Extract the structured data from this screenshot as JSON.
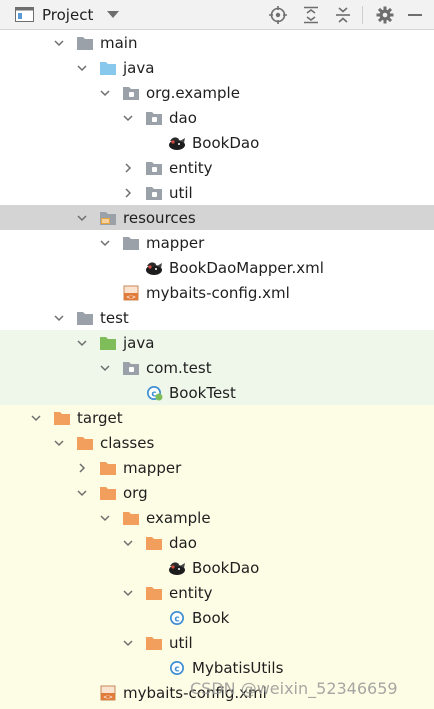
{
  "toolbar": {
    "title": "Project",
    "actions": [
      "locate-icon",
      "expand-all-icon",
      "collapse-all-icon",
      "settings-icon"
    ]
  },
  "colors": {
    "selected_row": "#d4d4d4",
    "test_band": "#eef7ea",
    "target_band": "#fdfde6",
    "folder_gray": "#9aa1a8",
    "folder_source": "#87c8ec",
    "folder_test": "#7ebd5a",
    "folder_excluded": "#f29e5c"
  },
  "tree": [
    {
      "label": "main",
      "depth": 2,
      "arrow": "down",
      "icon": "folder-gray"
    },
    {
      "label": "java",
      "depth": 3,
      "arrow": "down",
      "icon": "folder-source"
    },
    {
      "label": "org.example",
      "depth": 4,
      "arrow": "down",
      "icon": "package"
    },
    {
      "label": "dao",
      "depth": 5,
      "arrow": "down",
      "icon": "package"
    },
    {
      "label": "BookDao",
      "depth": 6,
      "arrow": "none",
      "icon": "mybatis"
    },
    {
      "label": "entity",
      "depth": 5,
      "arrow": "right",
      "icon": "package"
    },
    {
      "label": "util",
      "depth": 5,
      "arrow": "right",
      "icon": "package"
    },
    {
      "label": "resources",
      "depth": 3,
      "arrow": "down",
      "icon": "folder-resources",
      "selected": true
    },
    {
      "label": "mapper",
      "depth": 4,
      "arrow": "down",
      "icon": "folder-gray"
    },
    {
      "label": "BookDaoMapper.xml",
      "depth": 5,
      "arrow": "none",
      "icon": "mybatis"
    },
    {
      "label": "mybaits-config.xml",
      "depth": 4,
      "arrow": "none",
      "icon": "xml"
    },
    {
      "label": "test",
      "depth": 2,
      "arrow": "down",
      "icon": "folder-gray"
    },
    {
      "label": "java",
      "depth": 3,
      "arrow": "down",
      "icon": "folder-test"
    },
    {
      "label": "com.test",
      "depth": 4,
      "arrow": "down",
      "icon": "package"
    },
    {
      "label": "BookTest",
      "depth": 5,
      "arrow": "none",
      "icon": "class-test"
    },
    {
      "label": "target",
      "depth": 1,
      "arrow": "down",
      "icon": "folder-orange"
    },
    {
      "label": "classes",
      "depth": 2,
      "arrow": "down",
      "icon": "folder-orange"
    },
    {
      "label": "mapper",
      "depth": 3,
      "arrow": "right",
      "icon": "folder-orange"
    },
    {
      "label": "org",
      "depth": 3,
      "arrow": "down",
      "icon": "folder-orange"
    },
    {
      "label": "example",
      "depth": 4,
      "arrow": "down",
      "icon": "folder-orange"
    },
    {
      "label": "dao",
      "depth": 5,
      "arrow": "down",
      "icon": "folder-orange"
    },
    {
      "label": "BookDao",
      "depth": 6,
      "arrow": "none",
      "icon": "mybatis"
    },
    {
      "label": "entity",
      "depth": 5,
      "arrow": "down",
      "icon": "folder-orange"
    },
    {
      "label": "Book",
      "depth": 6,
      "arrow": "none",
      "icon": "class"
    },
    {
      "label": "util",
      "depth": 5,
      "arrow": "down",
      "icon": "folder-orange"
    },
    {
      "label": "MybatisUtils",
      "depth": 6,
      "arrow": "none",
      "icon": "class"
    },
    {
      "label": "mybaits-config.xml",
      "depth": 3,
      "arrow": "none",
      "icon": "xml"
    }
  ],
  "watermark": "CSDN @weixin_52346659"
}
